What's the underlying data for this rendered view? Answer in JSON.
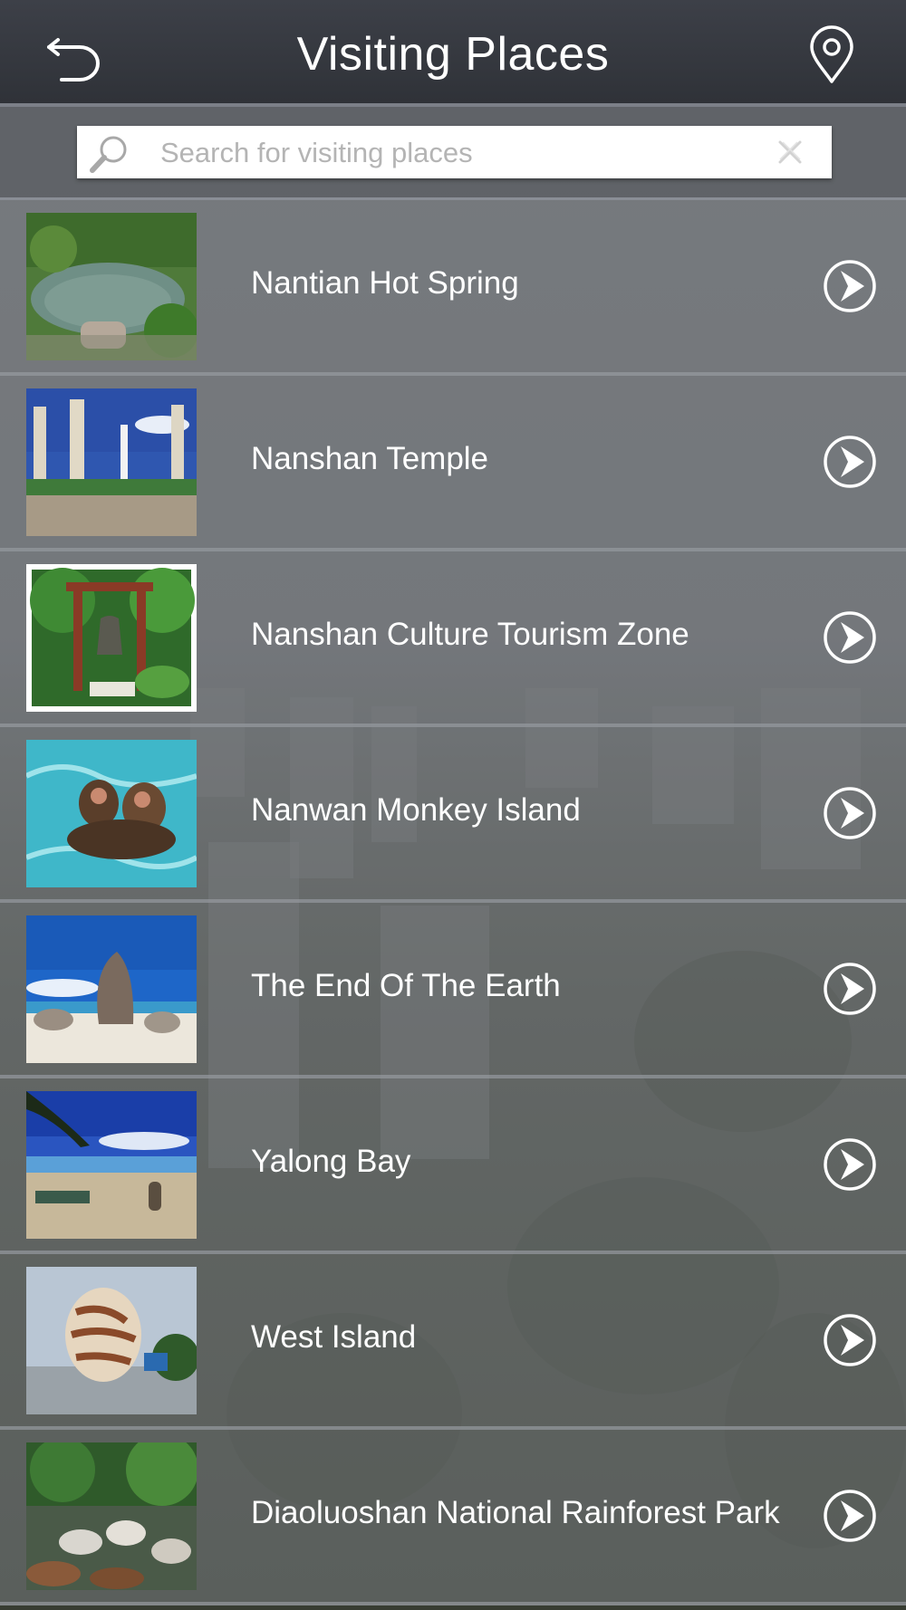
{
  "header": {
    "title": "Visiting Places",
    "back_icon": "back-arrow-icon",
    "location_icon": "map-pin-icon"
  },
  "search": {
    "placeholder": "Search for visiting places",
    "value": ""
  },
  "places": [
    {
      "name": "Nantian Hot Spring",
      "thumb": "hot-spring-pool"
    },
    {
      "name": "Nanshan Temple",
      "thumb": "temple-towers"
    },
    {
      "name": "Nanshan Culture Tourism Zone",
      "thumb": "bell-gate"
    },
    {
      "name": "Nanwan Monkey Island",
      "thumb": "monkeys-swimming"
    },
    {
      "name": "The End Of The Earth",
      "thumb": "beach-rocks"
    },
    {
      "name": "Yalong Bay",
      "thumb": "palm-beach"
    },
    {
      "name": "West Island",
      "thumb": "nautilus-shell"
    },
    {
      "name": "Diaoluoshan National Rainforest Park",
      "thumb": "rainforest-stream"
    }
  ],
  "colors": {
    "header_bg": "#34373d",
    "row_text": "#ffffff",
    "placeholder": "#b4b4b4"
  }
}
